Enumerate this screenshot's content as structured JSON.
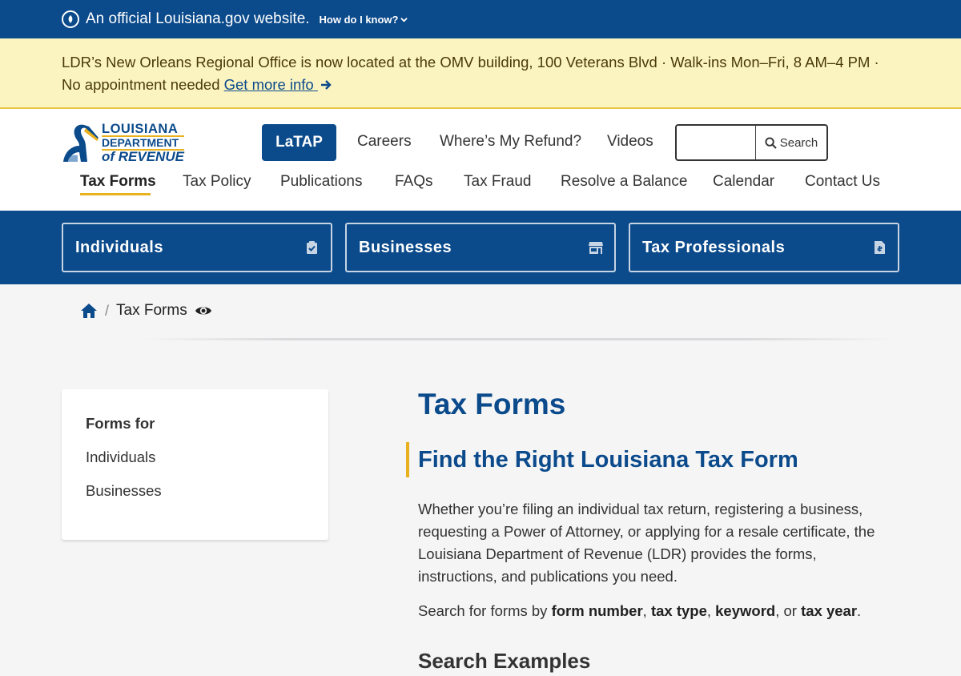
{
  "gov_banner": {
    "text": "An official Louisiana.gov website.",
    "how_label": "How do I know?"
  },
  "alert": {
    "text": "LDR’s New Orleans Regional Office is now located at the OMV building, 100 Veterans Blvd · Walk-ins Mon–Fri, 8 AM–4 PM · No appointment needed",
    "link_label": "Get more info"
  },
  "logo": {
    "line1": "LOUISIANA",
    "line2": "DEPARTMENT",
    "line3": "of REVENUE"
  },
  "top_nav": {
    "latap": "LaTAP",
    "careers": "Careers",
    "refund": "Where’s My Refund?",
    "videos": "Videos"
  },
  "search": {
    "placeholder": "",
    "button_label": "Search"
  },
  "main_nav": [
    {
      "label": "Tax Forms",
      "active": true
    },
    {
      "label": "Tax Policy"
    },
    {
      "label": "Publications"
    },
    {
      "label": "FAQs"
    },
    {
      "label": "Tax Fraud"
    },
    {
      "label": "Resolve a Balance"
    },
    {
      "label": "Calendar"
    },
    {
      "label": "Contact Us"
    }
  ],
  "audiences": [
    {
      "label": "Individuals",
      "icon": "clipboard-check-icon"
    },
    {
      "label": "Businesses",
      "icon": "store-icon"
    },
    {
      "label": "Tax Professionals",
      "icon": "file-invoice-icon"
    }
  ],
  "breadcrumb": {
    "separator": "/",
    "current": "Tax Forms"
  },
  "sidebar": {
    "heading": "Forms for",
    "items": [
      {
        "label": "Individuals"
      },
      {
        "label": "Businesses"
      }
    ]
  },
  "content": {
    "title": "Tax Forms",
    "subtitle": "Find the Right Louisiana Tax Form",
    "intro": "Whether you’re filing an individual tax return, registering a business, requesting a Power of Attorney, or applying for a resale certificate, the Louisiana Department of Revenue (LDR) provides the forms, instructions, and publications you need.",
    "search_hint": {
      "prefix": "Search for forms by ",
      "k1": "form number",
      "c1": ", ",
      "k2": "tax type",
      "c2": ", ",
      "k3": "keyword",
      "c3": ", or ",
      "k4": "tax year",
      "end": "."
    },
    "examples_heading": "Search Examples"
  },
  "colors": {
    "brand_blue": "#0b4a8b",
    "accent_gold": "#e8b21e",
    "alert_bg": "#fbf4c0"
  }
}
